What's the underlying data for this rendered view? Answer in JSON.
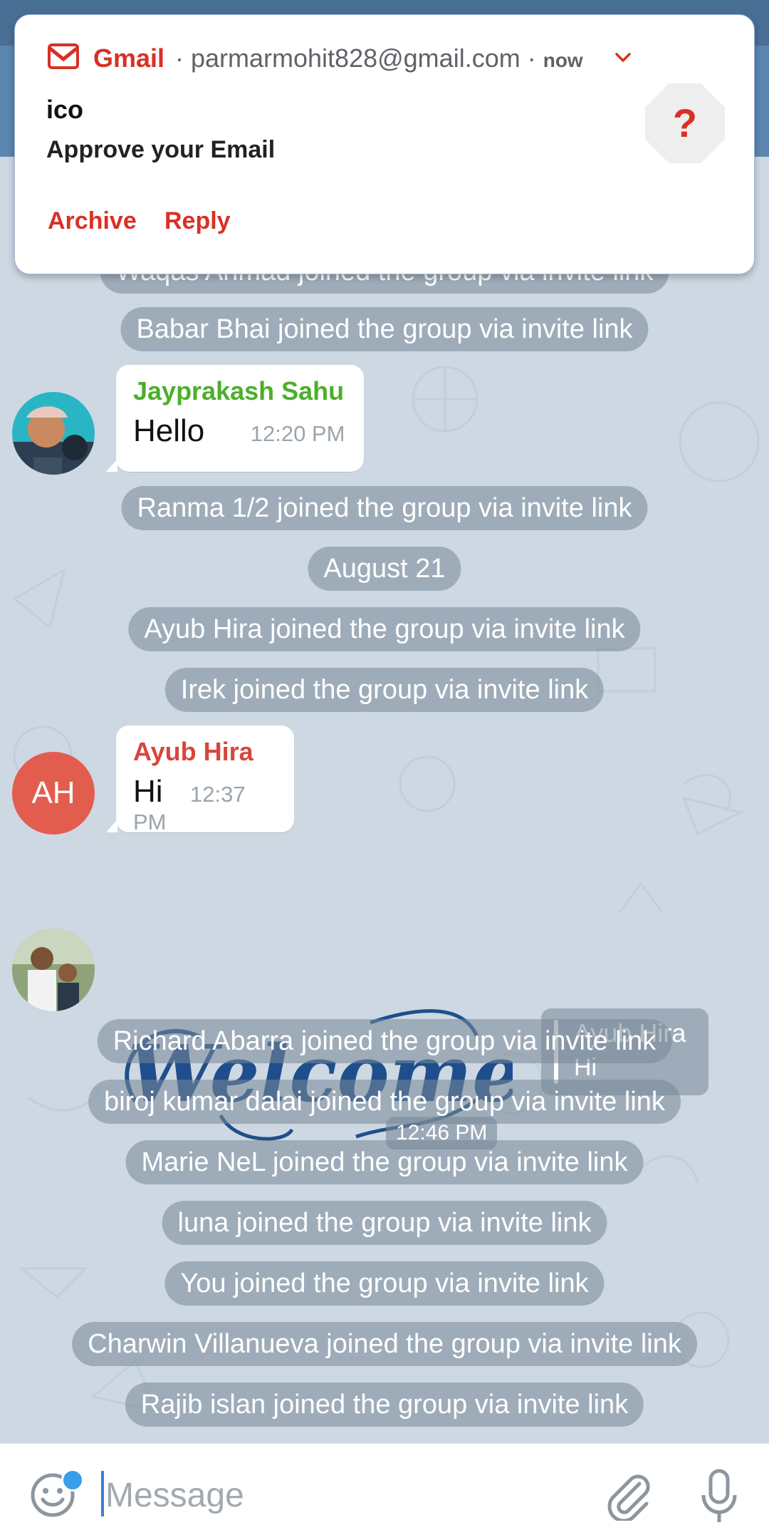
{
  "colors": {
    "gmail_red": "#d93025",
    "sender_green": "#4caf2a",
    "sender_red": "#d9453b",
    "avatar_ah": "#e35d4e",
    "pill_bg": "#7f90a0"
  },
  "notification": {
    "app": "Gmail",
    "account": "· parmarmohit828@gmail.com ·",
    "time": "now",
    "title": "ico",
    "body": "Approve your Email",
    "icon_glyph": "?",
    "actions": [
      "Archive",
      "Reply"
    ]
  },
  "chat": {
    "partial_pill": "Waqas Ahmad joined the group via invite link",
    "pill_babar": "Babar Bhai joined the group via invite link",
    "msg1": {
      "sender": "Jayprakash Sahu",
      "text": "Hello",
      "time": "12:20 PM"
    },
    "pill_ranma": "Ranma 1/2 joined the group via invite link",
    "date_separator": "August 21",
    "pill_ayub": "Ayub Hira joined the group via invite link",
    "pill_irek": "Irek joined the group via invite link",
    "msg2": {
      "sender": "Ayub Hira",
      "avatar_initials": "AH",
      "text": "Hi",
      "time": "12:37 PM"
    },
    "sticker": {
      "text": "Welcome",
      "time": "12:46 PM",
      "reply_name": "Ayub Hira",
      "reply_text": "Hi"
    },
    "pills_after": [
      "Richard Abarra joined the group via invite link",
      "biroj kumar dalai joined the group via invite link",
      "Marie NeL joined the group via invite link",
      "luna joined the group via invite link",
      "You joined the group via invite link",
      "Charwin Villanueva joined the group via invite link",
      "Rajib islan joined the group via invite link"
    ]
  },
  "input": {
    "placeholder": "Message"
  },
  "icons": {
    "emoji": "emoji-icon",
    "attach": "paperclip-icon",
    "mic": "microphone-icon",
    "gmail": "gmail-logo-icon",
    "expand": "chevron-down-icon"
  }
}
